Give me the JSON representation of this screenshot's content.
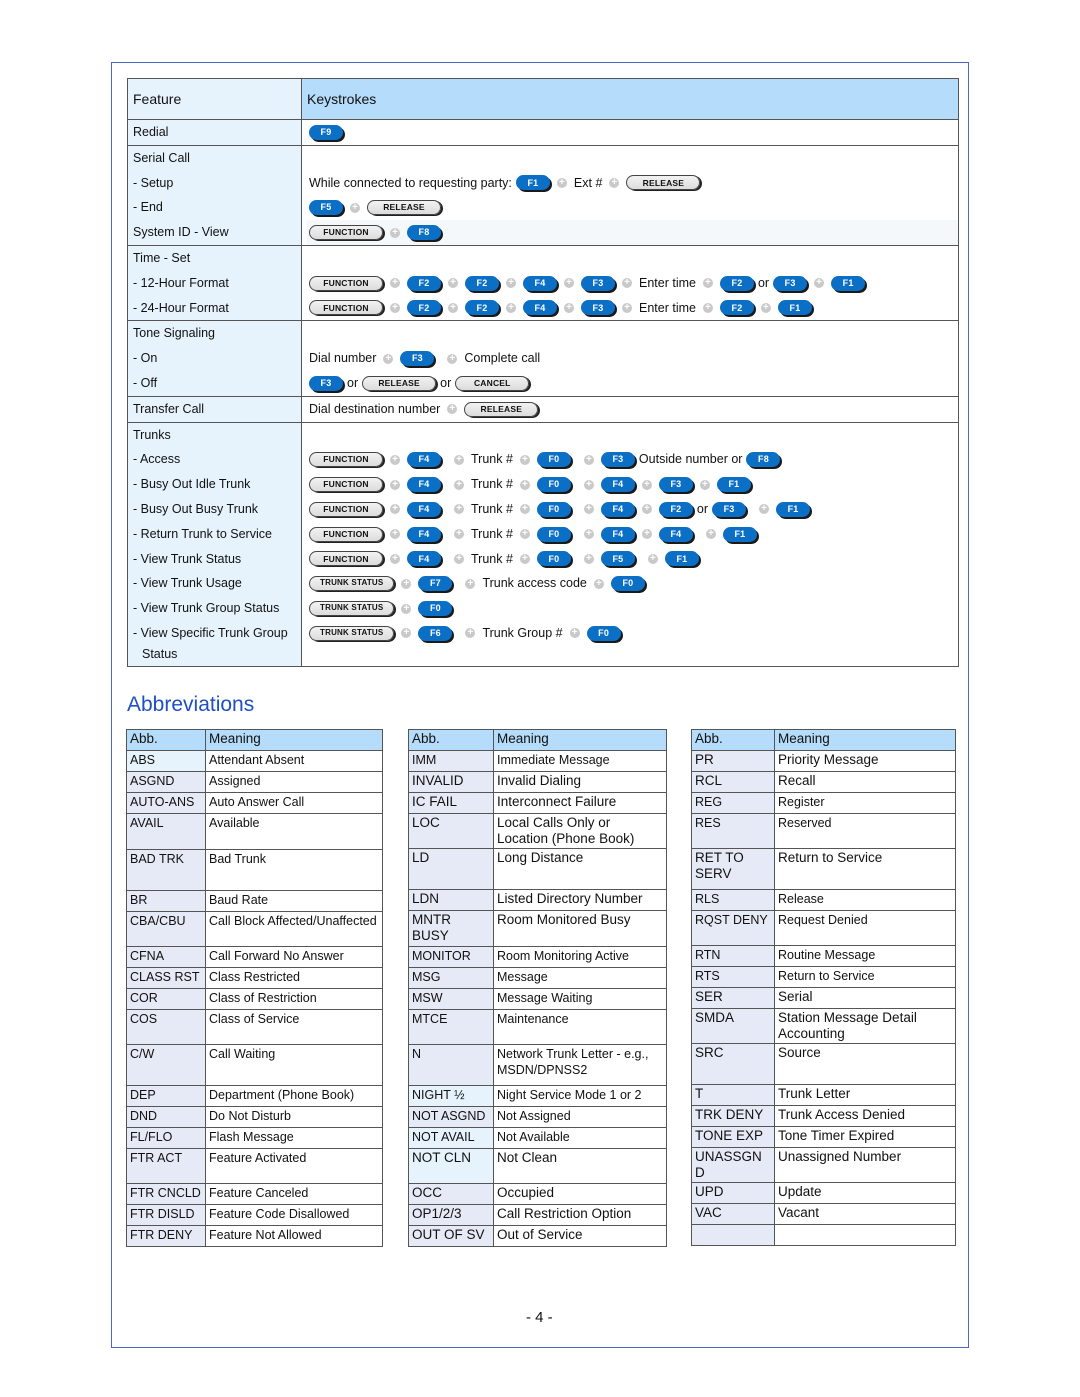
{
  "feature_table": {
    "headers": {
      "feature": "Feature",
      "keystrokes": "Keystrokes"
    },
    "connector_or": "or",
    "redial": {
      "label": "Redial",
      "keys": [
        "F9"
      ]
    },
    "serial_call": {
      "label": "Serial Call",
      "setup": {
        "label": "- Setup",
        "prefix": "While connected to requesting party:",
        "key1": "F1",
        "text": "Ext #",
        "key2": "RELEASE"
      },
      "end": {
        "label": "- End",
        "key1": "F5",
        "key2": "RELEASE"
      }
    },
    "system_id": {
      "label": "System ID - View",
      "key1": "FUNCTION",
      "key2": "F8"
    },
    "time_set": {
      "label": "Time - Set",
      "h12": {
        "label": "- 12-Hour Format",
        "keys": [
          "FUNCTION",
          "F2",
          "F2",
          "F4",
          "F3"
        ],
        "text": "Enter time",
        "key_a": "F2",
        "key_b": "F3",
        "key_c": "F1"
      },
      "h24": {
        "label": "- 24-Hour Format",
        "keys": [
          "FUNCTION",
          "F2",
          "F2",
          "F4",
          "F3"
        ],
        "text": "Enter time",
        "key_a": "F2",
        "key_c": "F1"
      }
    },
    "tone_signaling": {
      "label": "Tone Signaling",
      "on": {
        "label": "- On",
        "text1": "Dial number",
        "key1": "F3",
        "text2": "Complete call"
      },
      "off": {
        "label": "- Off",
        "key1": "F3",
        "key2": "RELEASE",
        "key3": "CANCEL"
      }
    },
    "transfer_call": {
      "label": "Transfer Call",
      "text": "Dial destination number",
      "key1": "RELEASE"
    },
    "trunks": {
      "label": "Trunks",
      "trunk_num": "Trunk #",
      "access": {
        "label": "- Access",
        "keys": [
          "FUNCTION",
          "F4",
          "F0",
          "F3",
          "F8"
        ],
        "text": "Outside number or"
      },
      "busy_idle": {
        "label": "- Busy Out Idle Trunk",
        "keys": [
          "FUNCTION",
          "F4",
          "F0",
          "F4",
          "F3",
          "F1"
        ]
      },
      "busy_busy": {
        "label": "- Busy Out Busy Trunk",
        "keys": [
          "FUNCTION",
          "F4",
          "F0",
          "F4",
          "F2",
          "F3",
          "F1"
        ]
      },
      "return": {
        "label": "- Return Trunk to Service",
        "keys": [
          "FUNCTION",
          "F4",
          "F0",
          "F4",
          "F4",
          "F1"
        ]
      },
      "view_status": {
        "label": "- View Trunk Status",
        "keys": [
          "FUNCTION",
          "F4",
          "F0",
          "F5",
          "F1"
        ]
      },
      "view_usage": {
        "label": "- View Trunk Usage",
        "keys": [
          "TRUNK STATUS",
          "F7",
          "F0"
        ],
        "text": "Trunk access code"
      },
      "view_group_status": {
        "label": "- View Trunk Group Status",
        "keys": [
          "TRUNK STATUS",
          "F0"
        ]
      },
      "view_specific": {
        "label": "- View Specific Trunk Group",
        "label2": "Status",
        "keys": [
          "TRUNK STATUS",
          "F6",
          "F0"
        ],
        "text": "Trunk Group #"
      }
    }
  },
  "abbreviations": {
    "title": "Abbreviations",
    "header": {
      "abb": "Abb.",
      "meaning": "Meaning"
    },
    "tables": [
      [
        [
          "ABS",
          "Attendant Absent"
        ],
        [
          "ASGND",
          "Assigned"
        ],
        [
          "AUTO-ANS",
          "Auto Answer Call"
        ],
        [
          "AVAIL",
          "Available"
        ],
        [
          "BAD TRK",
          "Bad Trunk"
        ],
        [
          "BR",
          "Baud Rate"
        ],
        [
          "CBA/CBU",
          "Call Block Affected/Unaffected"
        ],
        [
          "CFNA",
          "Call Forward No Answer"
        ],
        [
          "CLASS RST",
          "Class Restricted"
        ],
        [
          "COR",
          "Class of Restriction"
        ],
        [
          "COS",
          "Class of Service"
        ],
        [
          "C/W",
          "Call Waiting"
        ],
        [
          "DEP",
          "Department (Phone Book)"
        ],
        [
          "DND",
          "Do Not Disturb"
        ],
        [
          "FL/FLO",
          "Flash Message"
        ],
        [
          "FTR ACT",
          "Feature Activated"
        ],
        [
          "FTR CNCLD",
          "Feature Canceled"
        ],
        [
          "FTR DISLD",
          "Feature Code Disallowed"
        ],
        [
          "FTR DENY",
          "Feature Not Allowed"
        ]
      ],
      [
        [
          "IMM",
          "Immediate Message"
        ],
        [
          "INVALID",
          "Invalid Dialing"
        ],
        [
          "IC FAIL",
          "Interconnect Failure"
        ],
        [
          "LOC",
          "Local Calls Only or Location (Phone Book)"
        ],
        [
          "LD",
          "Long Distance"
        ],
        [
          "LDN",
          "Listed Directory Number"
        ],
        [
          "MNTR BUSY",
          "Room Monitored Busy"
        ],
        [
          "MONITOR",
          "Room Monitoring Active"
        ],
        [
          "MSG",
          "Message"
        ],
        [
          "MSW",
          "Message Waiting"
        ],
        [
          "MTCE",
          "Maintenance"
        ],
        [
          "N",
          "Network Trunk Letter - e.g., MSDN/DPNSS2"
        ],
        [
          "NIGHT ½",
          "Night Service Mode 1 or 2"
        ],
        [
          "NOT ASGND",
          "Not Assigned"
        ],
        [
          "NOT AVAIL",
          "Not Available"
        ],
        [
          "NOT CLN",
          "Not Clean"
        ],
        [
          "OCC",
          "Occupied"
        ],
        [
          "OP1/2/3",
          "Call Restriction Option"
        ],
        [
          "OUT OF SV",
          "Out of Service"
        ]
      ],
      [
        [
          "PR",
          "Priority Message"
        ],
        [
          "RCL",
          "Recall"
        ],
        [
          "REG",
          "Register"
        ],
        [
          "RES",
          "Reserved"
        ],
        [
          "RET TO SERV",
          "Return to Service"
        ],
        [
          "RLS",
          "Release"
        ],
        [
          "RQST DENY",
          "Request Denied"
        ],
        [
          "RTN",
          "Routine Message"
        ],
        [
          "RTS",
          "Return to Service"
        ],
        [
          "SER",
          "Serial"
        ],
        [
          "SMDA",
          "Station Message Detail Accounting"
        ],
        [
          "SRC",
          "Source"
        ],
        [
          "T",
          "Trunk Letter"
        ],
        [
          "TRK DENY",
          "Trunk Access Denied"
        ],
        [
          "TONE EXP",
          "Tone Timer Expired"
        ],
        [
          "UNASSGN D",
          "Unassigned Number"
        ],
        [
          "UPD",
          "Update"
        ],
        [
          "VAC",
          "Vacant"
        ],
        [
          "",
          ""
        ]
      ]
    ]
  },
  "footer": {
    "page_number": "- 4 -"
  },
  "colors": {
    "header_bg": "#b5dcfa",
    "feature_col_bg": "#e6f3fd",
    "key_blue": "#0b6fc6",
    "title_blue": "#1f4fc4",
    "frame": "#4a68c6"
  }
}
